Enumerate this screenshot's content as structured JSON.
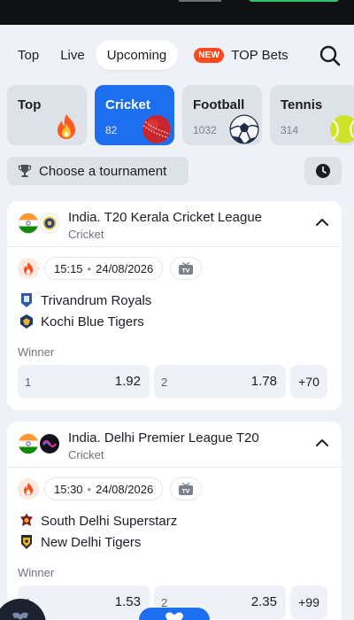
{
  "colors": {
    "accent": "#1e6ff0",
    "new_badge": "#ff4a1c",
    "background": "#eef1f5",
    "card": "#ffffff"
  },
  "tabs": [
    {
      "label": "Top",
      "active": false
    },
    {
      "label": "Live",
      "active": false
    },
    {
      "label": "Upcoming",
      "active": true
    },
    {
      "label": "TOP Bets",
      "badge": "NEW",
      "active": false
    }
  ],
  "search": {
    "icon": "search-icon"
  },
  "sports": [
    {
      "name": "Top",
      "count": "",
      "icon": "fire-icon"
    },
    {
      "name": "Cricket",
      "count": "82",
      "icon": "cricket-ball-icon",
      "active": true
    },
    {
      "name": "Football",
      "count": "1032",
      "icon": "football-icon"
    },
    {
      "name": "Tennis",
      "count": "314",
      "icon": "tennis-ball-icon"
    }
  ],
  "tournament": {
    "label": "Choose a tournament",
    "icon": "trophy-icon"
  },
  "time_filter": {
    "icon": "clock-icon"
  },
  "events": [
    {
      "league": "India. T20 Kerala Cricket League",
      "sport": "Cricket",
      "time": "15:15",
      "date": "24/08/2026",
      "team1": "Trivandrum Royals",
      "team2": "Kochi Blue Tigers",
      "market": "Winner",
      "odds": [
        {
          "label": "1",
          "value": "1.92"
        },
        {
          "label": "2",
          "value": "1.78"
        }
      ],
      "more": "+70"
    },
    {
      "league": "India. Delhi Premier League T20",
      "sport": "Cricket",
      "time": "15:30",
      "date": "24/08/2026",
      "team1": "South Delhi Superstarz",
      "team2": "New Delhi Tigers",
      "market": "Winner",
      "odds": [
        {
          "label": "1",
          "value": "1.53"
        },
        {
          "label": "2",
          "value": "2.35"
        }
      ],
      "more": "+99"
    }
  ]
}
